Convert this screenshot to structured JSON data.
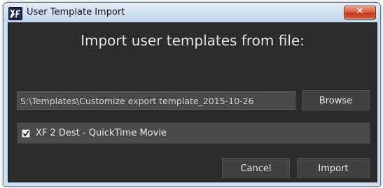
{
  "window": {
    "title": "User Template Import",
    "close_glyph": "✕",
    "app_icon": "xf-logo-icon"
  },
  "dialog": {
    "heading": "Import user templates from file:",
    "path_value": "S:\\Templates\\Customize export template_2015-10-26",
    "browse_label": "Browse",
    "templates": [
      {
        "label": "XF 2 Dest - QuickTime Movie",
        "checked": true
      }
    ],
    "cancel_label": "Cancel",
    "import_label": "Import"
  }
}
